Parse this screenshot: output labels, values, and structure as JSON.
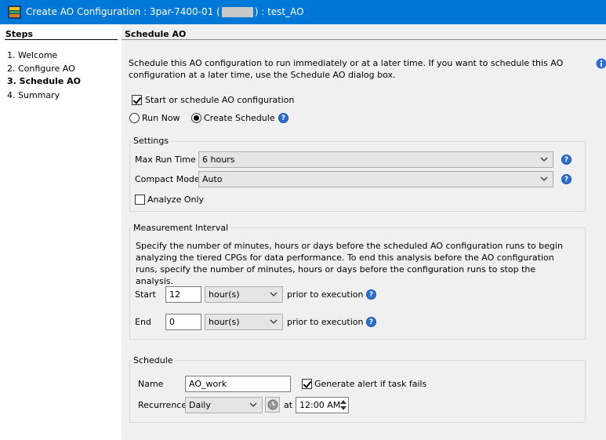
{
  "window": {
    "title_prefix": "Create AO Configuration : 3par-7400-01 (",
    "title_suffix": ") : test_AO"
  },
  "steps": {
    "heading": "Steps",
    "items": [
      {
        "label": "1. Welcome",
        "active": false
      },
      {
        "label": "2. Configure AO",
        "active": false
      },
      {
        "label": "3. Schedule AO",
        "active": true
      },
      {
        "label": "4. Summary",
        "active": false
      }
    ]
  },
  "main": {
    "heading": "Schedule AO",
    "intro": "Schedule this AO configuration to run immediately or at a later time. If you want to schedule this AO configuration at a later time, use the Schedule AO dialog box.",
    "start_checkbox_label": "Start or schedule AO configuration",
    "run_now_label": "Run Now",
    "create_schedule_label": "Create Schedule",
    "help_glyph": "?"
  },
  "settings": {
    "title": "Settings",
    "max_run_time_label": "Max Run Time",
    "max_run_time_value": "6 hours",
    "compact_mode_label": "Compact Mode",
    "compact_mode_value": "Auto",
    "analyze_only_label": "Analyze Only"
  },
  "measurement": {
    "title": "Measurement Interval",
    "description": "Specify the number of minutes, hours or days before the scheduled AO configuration runs to begin analyzing the tiered CPGs  for data performance. To end this analysis before the AO configuration runs, specify the number of minutes, hours or days before the configuration runs to stop the analysis.",
    "start_label": "Start",
    "start_value": "12",
    "start_unit": "hour(s)",
    "end_label": "End",
    "end_value": "0",
    "end_unit": "hour(s)",
    "prior_label": "prior to execution"
  },
  "schedule": {
    "title": "Schedule",
    "name_label": "Name",
    "name_value": "AO_work",
    "alert_label": "Generate alert if task fails",
    "recurrence_label": "Recurrence",
    "recurrence_value": "Daily",
    "at_label": "at",
    "time_value": "12:00 AM"
  },
  "colors": {
    "titlebar": "#0078d7",
    "help_icon": "#2b6fd6"
  },
  "icons": {
    "app": "ao-config-app-icon",
    "info": "info-icon",
    "help": "help-icon",
    "clock": "clock-icon"
  }
}
